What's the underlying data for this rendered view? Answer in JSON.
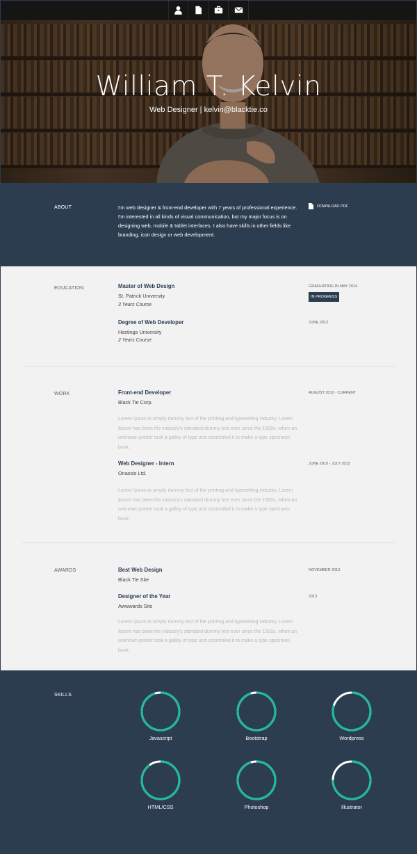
{
  "nav": {
    "items": [
      {
        "icon": "user-icon"
      },
      {
        "icon": "document-icon"
      },
      {
        "icon": "briefcase-icon"
      },
      {
        "icon": "envelope-icon"
      }
    ]
  },
  "hero": {
    "name": "William T. Kelvin",
    "subtitle": "Web Designer | kelvin@blacktie.co"
  },
  "about": {
    "label": "ABOUT",
    "text": "I'm web designer & front-end developer with 7 years of professional experience. I'm interested in all kinds of visual communication, but my major focus is on designing web, mobile & tablet interfaces. I also have skills in other fields like branding, icon design or web development.",
    "download_label": "DOWNLOAD PDF"
  },
  "education": {
    "label": "EDUCATION",
    "items": [
      {
        "title": "Master of Web Design",
        "place": "St. Patrick University",
        "note": "3 Years Course",
        "date": "GRADUATING IN MAY 2014",
        "badge": "IN PROGRESS"
      },
      {
        "title": "Degree of Web Developer",
        "place": "Hastings University",
        "note": "2 Years Course",
        "date": "JUNE 2012"
      }
    ]
  },
  "work": {
    "label": "WORK",
    "items": [
      {
        "title": "Front-end Developer",
        "place": "Black Tie Corp.",
        "desc": "Lorem Ipsum is simply dummy text of the printing and typesetting industry. Lorem Ipsum has been the industry's standard dummy text ever since the 1500s, when an unknown printer took a galley of type and scrambled it to make a type specimen book.",
        "date": "AUGUST 2012 - CURRENT"
      },
      {
        "title": "Web Designer - Intern",
        "place": "Onassis Ltd.",
        "desc": "Lorem Ipsum is simply dummy text of the printing and typesetting industry. Lorem Ipsum has been the industry's standard dummy text ever since the 1500s, when an unknown printer took a galley of type and scrambled it to make a type specimen book.",
        "date": "JUNE 2010 - JULY 2012"
      }
    ]
  },
  "awards": {
    "label": "AWARDS",
    "items": [
      {
        "title": "Best Web Design",
        "place": "Black Tie Site",
        "date": "NOVEMBER 2013"
      },
      {
        "title": "Designer of the Year",
        "place": "Awwwards Site",
        "date": "2013",
        "desc": "Lorem Ipsum is simply dummy text of the printing and typesetting industry. Lorem Ipsum has been the industry's standard dummy text ever since the 1500s, when an unknown printer took a galley of type and scrambled it to make a type specimen book."
      }
    ]
  },
  "skills": {
    "label": "SKILLS",
    "accent_color": "#1abc9c",
    "track_color": "#ffffff",
    "items": [
      {
        "name": "Javascript",
        "level": 0.95
      },
      {
        "name": "Bootstrap",
        "level": 0.95
      },
      {
        "name": "Wordpress",
        "level": 0.8
      },
      {
        "name": "HTML/CSS",
        "level": 0.9
      },
      {
        "name": "Photoshop",
        "level": 0.95
      },
      {
        "name": "Illustrator",
        "level": 0.75
      }
    ]
  },
  "colors": {
    "dark_section": "#2d3d50",
    "light_section": "#f2f2f2",
    "nav_bg": "#151515"
  }
}
